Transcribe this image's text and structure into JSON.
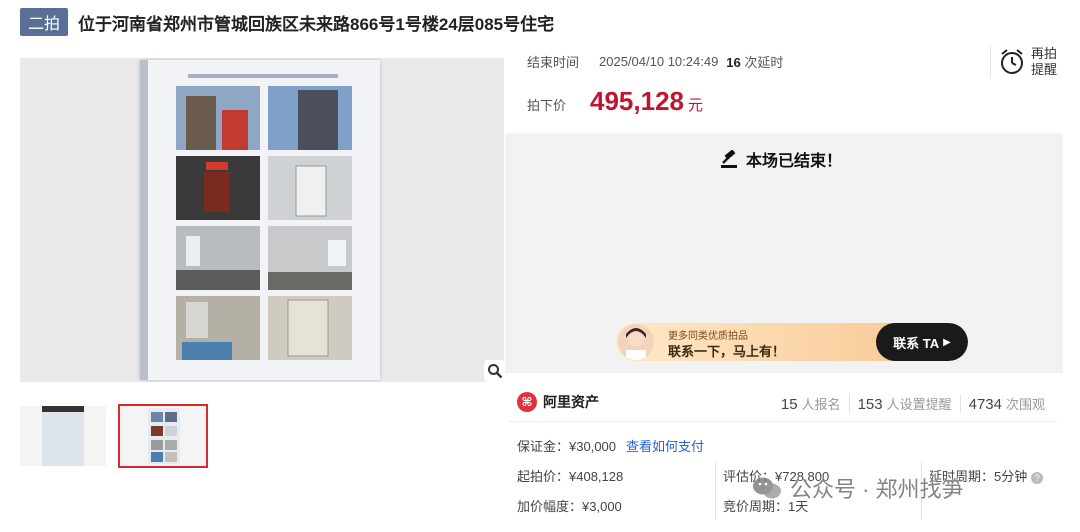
{
  "header": {
    "tag": "二拍",
    "title": "位于河南省郑州市管城回族区未来路866号1号楼24层085号住宅"
  },
  "auction": {
    "end_label": "结束时间",
    "end_time": "2025/04/10 10:24:49",
    "delay_count": "16",
    "delay_label": "次延时",
    "price_label": "拍下价",
    "price": "495,128",
    "price_unit": "元",
    "remind_label": "再拍提醒"
  },
  "status": {
    "ended_text": "本场已结束！"
  },
  "banner": {
    "small_text": "更多同类优质拍品",
    "big_text": "联系一下，马上有！",
    "button_label": "联系 TA"
  },
  "platform": {
    "name": "阿里资产",
    "stats": [
      {
        "num": "15",
        "label": "人报名"
      },
      {
        "num": "153",
        "label": "人设置提醒"
      },
      {
        "num": "4734",
        "label": "次围观"
      }
    ]
  },
  "details": {
    "deposit_label": "保证金：",
    "deposit": "¥30,000",
    "pay_link": "查看如何支付",
    "start_label": "起拍价：",
    "start_price": "¥408,128",
    "appraisal_label": "评估价：",
    "appraisal": "¥728,800",
    "delay_period_label": "延时周期：",
    "delay_period": "5分钟",
    "increment_label": "加价幅度：",
    "increment": "¥3,000",
    "bid_period_label": "竞价周期：",
    "bid_period": "1天"
  },
  "watermark": {
    "text": "公众号 · 郑州找笋"
  },
  "colors": {
    "accent_red": "#c0152f",
    "tag_blue": "#5a6f96",
    "link_blue": "#2a62c9"
  }
}
